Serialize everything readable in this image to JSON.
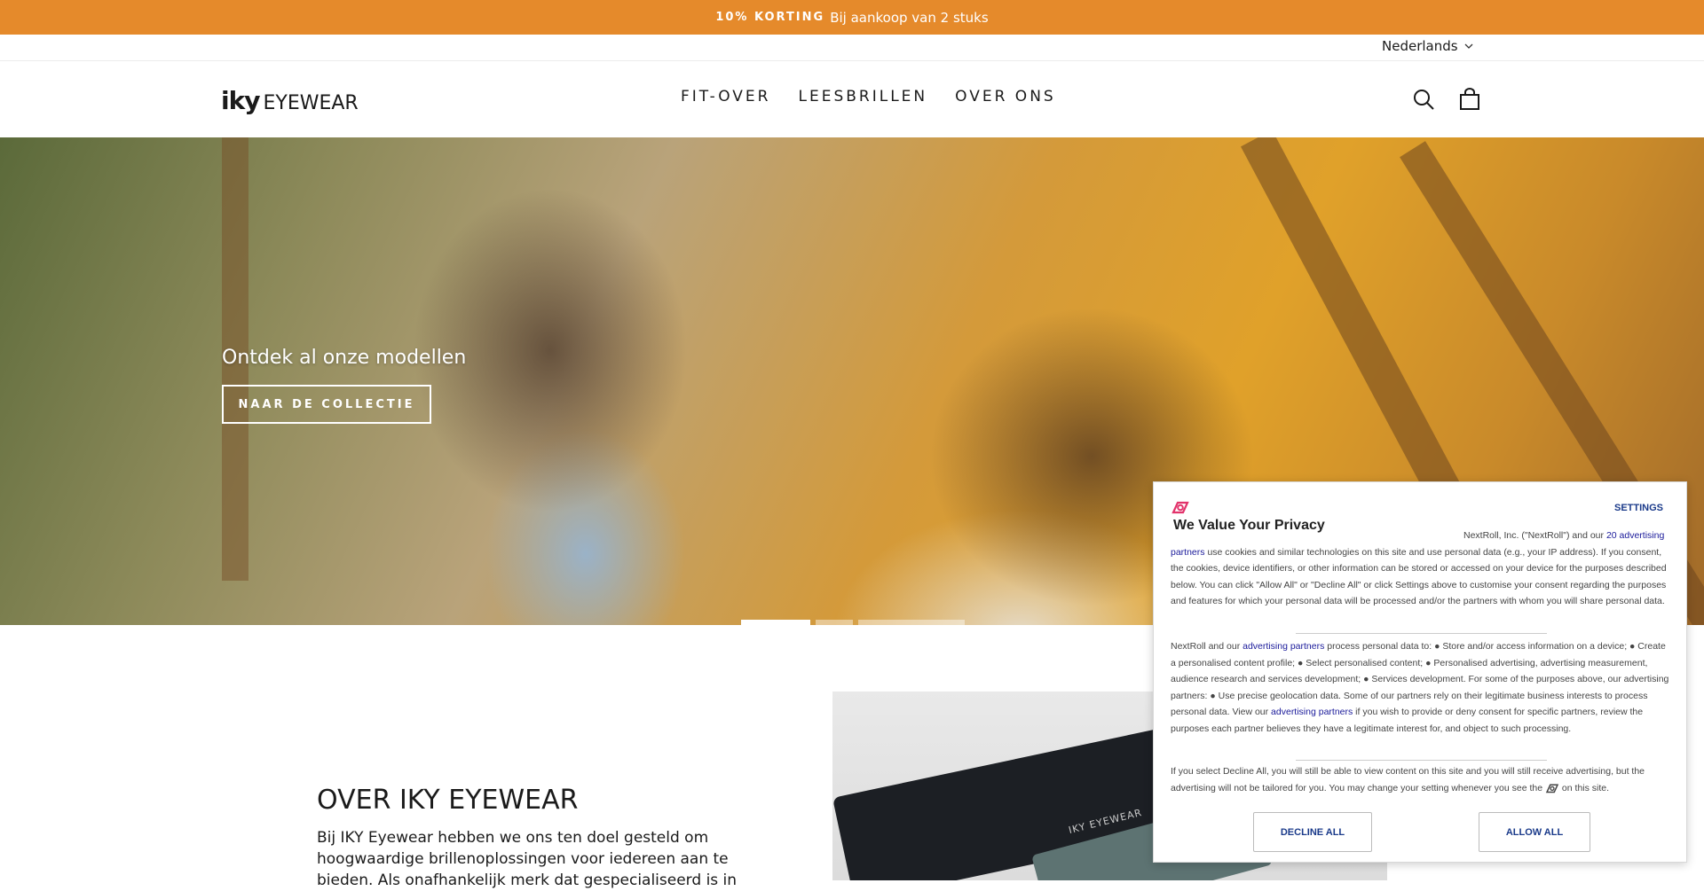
{
  "announcement": {
    "strong": "10% KORTING",
    "text": "Bij aankoop van 2 stuks",
    "bg": "#e58a2b"
  },
  "language": {
    "label": "Nederlands"
  },
  "header": {
    "logo_bold": "iky",
    "logo_rest": "EYEWEAR",
    "nav": [
      {
        "label": "FIT-OVER"
      },
      {
        "label": "LEESBRILLEN"
      },
      {
        "label": "OVER ONS"
      }
    ],
    "icons": [
      "search-icon",
      "cart-icon"
    ]
  },
  "hero": {
    "title": "Ontdek al onze modellen",
    "button": "NAAR DE COLLECTIE",
    "slide_count": 3,
    "active_slide": 1
  },
  "about": {
    "title": "OVER IKY EYEWEAR",
    "text": "Bij IKY Eyewear hebben we ons ten doel gesteld om hoogwaardige brillenoplossingen voor iedereen aan te bieden. Als onafhankelijk merk dat gespecialiseerd is in",
    "image_brand": "IKY EYEWEAR"
  },
  "consent": {
    "settings": "SETTINGS",
    "title": "We Value Your Privacy",
    "p1_a": "NextRoll, Inc. (\"NextRoll\") and our ",
    "p1_link": "20 advertising partners",
    "p1_b": " use cookies and similar technologies on this site and use personal data (e.g., your IP address). If you consent, the cookies, device identifiers, or other information can be stored or accessed on your device for the purposes described below. You can click \"Allow All\" or \"Decline All\" or click Settings above to customise your consent regarding the purposes and features for which your personal data will be processed and/or the partners with whom you will share personal data.",
    "p2_a": "NextRoll and our ",
    "p2_link": "advertising partners",
    "p2_b": " process personal data to: ● Store and/or access information on a device; ● Create a personalised content profile; ● Select personalised content; ● Personalised advertising, advertising measurement, audience research and services development; ● Services development. For some of the purposes above, our advertising partners: ● Use precise geolocation data. Some of our partners rely on their legitimate business interests to process personal data. View our ",
    "p2_link2": "advertising partners",
    "p2_c": " if you wish to provide or deny consent for specific partners, review the purposes each partner believes they have a legitimate interest for, and object to such processing.",
    "p3_a": "If you select Decline All, you will still be able to view content on this site and you will still receive advertising, but the advertising will not be tailored for you. You may change your setting whenever you see the ",
    "p3_b": " on this site.",
    "decline": "DECLINE ALL",
    "allow": "ALLOW ALL",
    "accent": "#e2336b"
  }
}
